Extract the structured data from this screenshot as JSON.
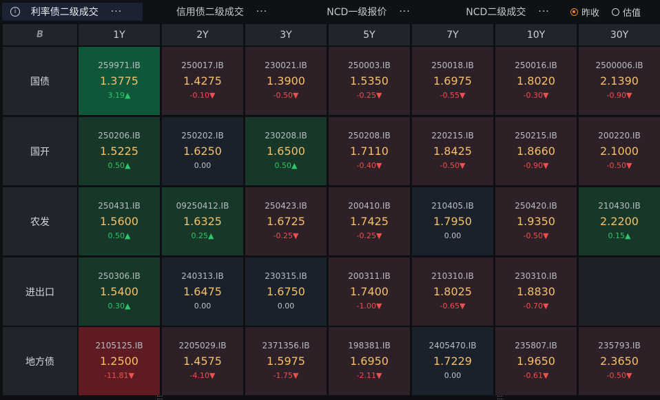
{
  "tabs": [
    {
      "label": "利率债二级成交",
      "more": "···",
      "active": true
    },
    {
      "label": "信用债二级成交",
      "more": "···",
      "active": false
    },
    {
      "label": "NCD一级报价",
      "more": "···",
      "active": false
    },
    {
      "label": "NCD二级成交",
      "more": "···",
      "active": false
    }
  ],
  "radios": [
    {
      "label": "昨收",
      "selected": true
    },
    {
      "label": "估值",
      "selected": false
    }
  ],
  "table": {
    "corner_logo": "B",
    "columns": [
      "1Y",
      "2Y",
      "3Y",
      "5Y",
      "7Y",
      "10Y",
      "30Y"
    ],
    "rows": [
      {
        "label": "国债",
        "cells": [
          {
            "code": "259971.IB",
            "rate": "1.3775",
            "change": "3.19▲",
            "dir": "up",
            "shade": "green2"
          },
          {
            "code": "250017.IB",
            "rate": "1.4275",
            "change": "-0.10▼",
            "dir": "down",
            "shade": "red1"
          },
          {
            "code": "230021.IB",
            "rate": "1.3900",
            "change": "-0.50▼",
            "dir": "down",
            "shade": "red1"
          },
          {
            "code": "250003.IB",
            "rate": "1.5350",
            "change": "-0.25▼",
            "dir": "down",
            "shade": "red1"
          },
          {
            "code": "250018.IB",
            "rate": "1.6975",
            "change": "-0.55▼",
            "dir": "down",
            "shade": "red1"
          },
          {
            "code": "250016.IB",
            "rate": "1.8020",
            "change": "-0.30▼",
            "dir": "down",
            "shade": "red1"
          },
          {
            "code": "2500006.IB",
            "rate": "2.1390",
            "change": "-0.90▼",
            "dir": "down",
            "shade": "red1"
          }
        ]
      },
      {
        "label": "国开",
        "cells": [
          {
            "code": "250206.IB",
            "rate": "1.5225",
            "change": "0.50▲",
            "dir": "up",
            "shade": "green1"
          },
          {
            "code": "250202.IB",
            "rate": "1.6250",
            "change": "0.00",
            "dir": "flat",
            "shade": "neutral"
          },
          {
            "code": "230208.IB",
            "rate": "1.6500",
            "change": "0.50▲",
            "dir": "up",
            "shade": "green1"
          },
          {
            "code": "250208.IB",
            "rate": "1.7110",
            "change": "-0.40▼",
            "dir": "down",
            "shade": "red1"
          },
          {
            "code": "220215.IB",
            "rate": "1.8425",
            "change": "-0.50▼",
            "dir": "down",
            "shade": "red1"
          },
          {
            "code": "250215.IB",
            "rate": "1.8660",
            "change": "-0.90▼",
            "dir": "down",
            "shade": "red1"
          },
          {
            "code": "200220.IB",
            "rate": "2.1000",
            "change": "-0.50▼",
            "dir": "down",
            "shade": "red1"
          }
        ]
      },
      {
        "label": "农发",
        "cells": [
          {
            "code": "250431.IB",
            "rate": "1.5600",
            "change": "0.50▲",
            "dir": "up",
            "shade": "green1"
          },
          {
            "code": "09250412.IB",
            "rate": "1.6325",
            "change": "0.25▲",
            "dir": "up",
            "shade": "green1"
          },
          {
            "code": "250423.IB",
            "rate": "1.6725",
            "change": "-0.25▼",
            "dir": "down",
            "shade": "red1"
          },
          {
            "code": "200410.IB",
            "rate": "1.7425",
            "change": "-0.25▼",
            "dir": "down",
            "shade": "red1"
          },
          {
            "code": "210405.IB",
            "rate": "1.7950",
            "change": "0.00",
            "dir": "flat",
            "shade": "neutral"
          },
          {
            "code": "250420.IB",
            "rate": "1.9350",
            "change": "-0.50▼",
            "dir": "down",
            "shade": "red1"
          },
          {
            "code": "210430.IB",
            "rate": "2.2200",
            "change": "0.15▲",
            "dir": "up",
            "shade": "green1"
          }
        ]
      },
      {
        "label": "进出口",
        "cells": [
          {
            "code": "250306.IB",
            "rate": "1.5400",
            "change": "0.30▲",
            "dir": "up",
            "shade": "green1"
          },
          {
            "code": "240313.IB",
            "rate": "1.6475",
            "change": "0.00",
            "dir": "flat",
            "shade": "neutral"
          },
          {
            "code": "230315.IB",
            "rate": "1.6750",
            "change": "0.00",
            "dir": "flat",
            "shade": "neutral"
          },
          {
            "code": "200311.IB",
            "rate": "1.7400",
            "change": "-1.00▼",
            "dir": "down",
            "shade": "red1"
          },
          {
            "code": "210310.IB",
            "rate": "1.8025",
            "change": "-0.65▼",
            "dir": "down",
            "shade": "red1"
          },
          {
            "code": "230310.IB",
            "rate": "1.8830",
            "change": "-0.70▼",
            "dir": "down",
            "shade": "red1"
          },
          {
            "code": "",
            "rate": "",
            "change": "",
            "dir": "flat",
            "shade": "empty"
          }
        ]
      },
      {
        "label": "地方债",
        "cells": [
          {
            "code": "2105125.IB",
            "rate": "1.2500",
            "change": "-11.81▼",
            "dir": "down",
            "shade": "red3"
          },
          {
            "code": "2205029.IB",
            "rate": "1.4575",
            "change": "-4.10▼",
            "dir": "down",
            "shade": "red1"
          },
          {
            "code": "2371356.IB",
            "rate": "1.5975",
            "change": "-1.75▼",
            "dir": "down",
            "shade": "red1"
          },
          {
            "code": "198381.IB",
            "rate": "1.6950",
            "change": "-2.11▼",
            "dir": "down",
            "shade": "red1"
          },
          {
            "code": "2405470.IB",
            "rate": "1.7229",
            "change": "0.00",
            "dir": "flat",
            "shade": "neutral"
          },
          {
            "code": "235807.IB",
            "rate": "1.9650",
            "change": "-0.61▼",
            "dir": "down",
            "shade": "red1"
          },
          {
            "code": "235793.IB",
            "rate": "2.3650",
            "change": "-0.50▼",
            "dir": "down",
            "shade": "red1"
          }
        ]
      }
    ]
  },
  "colors": {
    "green1": "#173829",
    "green2": "#10573a",
    "red1": "#2e2027",
    "red3": "#5e1c22",
    "neutral": "#1b212b",
    "empty": "#1e2128",
    "accent": "#e8842f"
  }
}
